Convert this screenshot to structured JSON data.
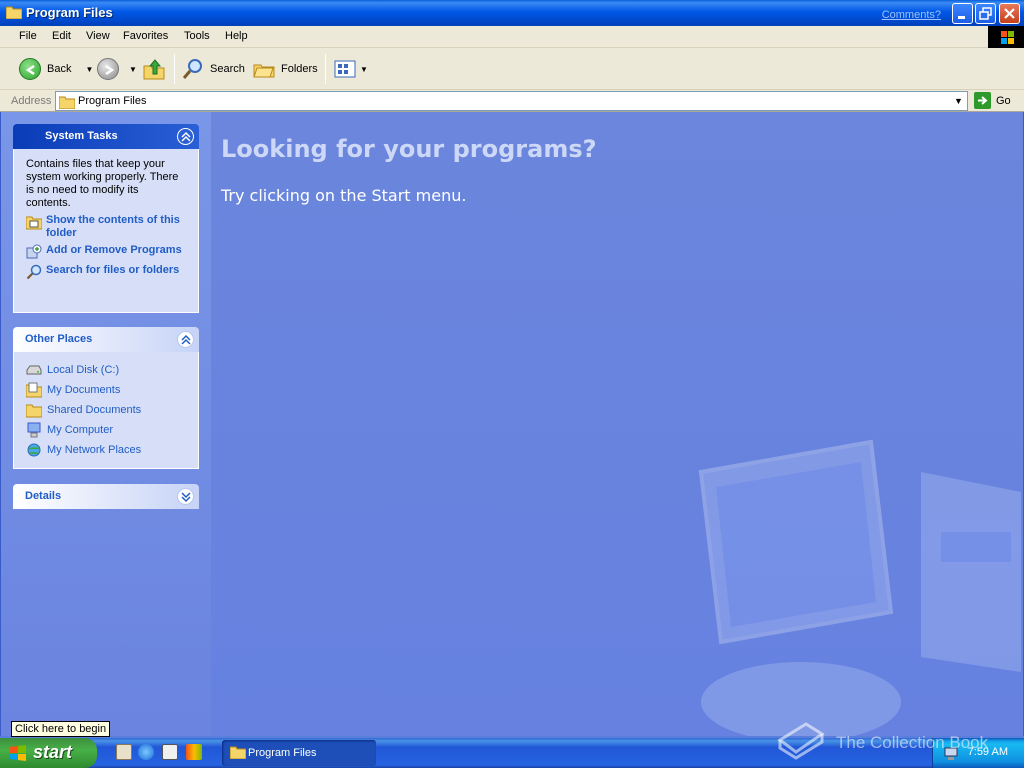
{
  "window": {
    "title": "Program Files",
    "comments_link": "Comments?"
  },
  "menu": {
    "items": [
      "File",
      "Edit",
      "View",
      "Favorites",
      "Tools",
      "Help"
    ]
  },
  "toolbar": {
    "back_label": "Back",
    "search_label": "Search",
    "folders_label": "Folders"
  },
  "address": {
    "label": "Address",
    "value": "Program Files",
    "go_label": "Go"
  },
  "sidebar": {
    "system_tasks": {
      "title": "System Tasks",
      "description": "Contains files that keep your system working properly. There is no need to modify its contents.",
      "links": [
        {
          "label": "Show the contents of this folder",
          "icon": "folder-view-icon"
        },
        {
          "label": "Add or Remove Programs",
          "icon": "add-remove-programs-icon"
        },
        {
          "label": "Search for files or folders",
          "icon": "search-icon"
        }
      ]
    },
    "other_places": {
      "title": "Other Places",
      "links": [
        {
          "label": "Local Disk (C:)",
          "icon": "disk-drive-icon"
        },
        {
          "label": "My Documents",
          "icon": "my-documents-icon"
        },
        {
          "label": "Shared Documents",
          "icon": "folder-icon"
        },
        {
          "label": "My Computer",
          "icon": "computer-icon"
        },
        {
          "label": "My Network Places",
          "icon": "network-icon"
        }
      ]
    },
    "details": {
      "title": "Details"
    }
  },
  "main": {
    "heading": "Looking for your programs?",
    "subtext": "Try clicking on the Start menu."
  },
  "taskbar": {
    "tooltip": "Click here to begin",
    "start_label": "start",
    "task_item": "Program Files",
    "clock": "7:59 AM",
    "watermark": "The Collection Book"
  },
  "colors": {
    "title_blue": "#0058e6",
    "link_blue": "#215dc6",
    "main_bg": "#6681e0",
    "start_green": "#48b048"
  }
}
